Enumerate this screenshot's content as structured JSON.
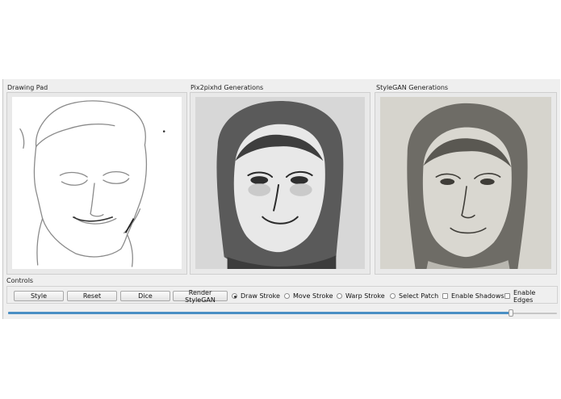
{
  "panels": {
    "drawing_pad": {
      "title": "Drawing Pad"
    },
    "pix2pix": {
      "title": "Pix2pixhd Generations"
    },
    "stylegan": {
      "title": "StyleGAN Generations"
    }
  },
  "controls": {
    "title": "Controls",
    "buttons": {
      "style": "Style",
      "reset": "Reset",
      "dice": "Dice",
      "render": "Render StyleGAN"
    },
    "modes": [
      {
        "label": "Draw Stroke",
        "selected": true
      },
      {
        "label": "Move Stroke",
        "selected": false
      },
      {
        "label": "Warp Stroke",
        "selected": false
      },
      {
        "label": "Select Patch",
        "selected": false
      }
    ],
    "toggles": [
      {
        "label": "Enable Shadows",
        "checked": false
      },
      {
        "label": "Enable Edges",
        "checked": false
      }
    ],
    "slider_value": 0.92
  },
  "colors": {
    "window_bg": "#efefef",
    "slider_fill": "#4a8fc4"
  }
}
